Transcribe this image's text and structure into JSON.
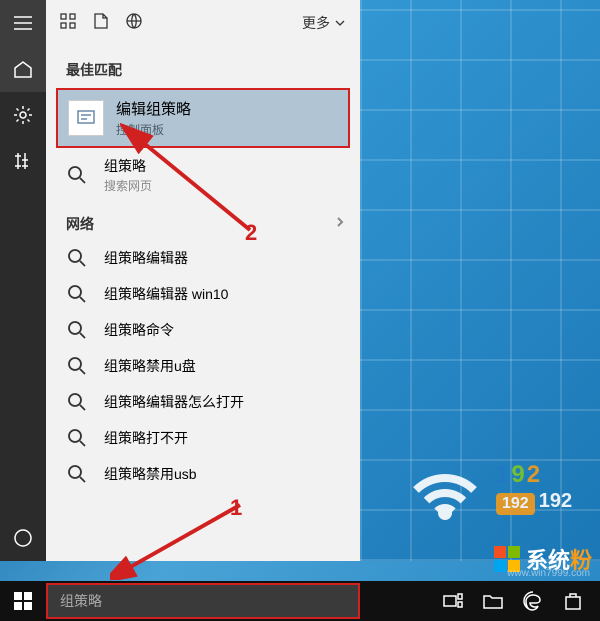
{
  "sidebar": {
    "items": [
      "menu",
      "home",
      "settings",
      "timeline",
      "cortana"
    ]
  },
  "searchPanel": {
    "top": {
      "moreLabel": "更多"
    },
    "bestMatchHeader": "最佳匹配",
    "bestMatch": {
      "title": "编辑组策略",
      "subtitle": "控制面板"
    },
    "primaryResult": {
      "title": "组策略",
      "subtitle": "搜索网页"
    },
    "networkHeader": "网络",
    "networkResults": [
      "组策略编辑器",
      "组策略编辑器 win10",
      "组策略命令",
      "组策略禁用u盘",
      "组策略编辑器怎么打开",
      "组策略打不开",
      "组策略禁用usb"
    ]
  },
  "annotations": {
    "one": "1",
    "two": "2"
  },
  "taskbar": {
    "searchValue": "组策略"
  },
  "overlay": {
    "ipDigits": [
      "1",
      "9",
      "2"
    ],
    "ipBadge": "192",
    "ipTail": "192"
  },
  "watermark": {
    "brandMain": "系统",
    "brandAccent": "粉",
    "url": "www.win7999.com"
  }
}
